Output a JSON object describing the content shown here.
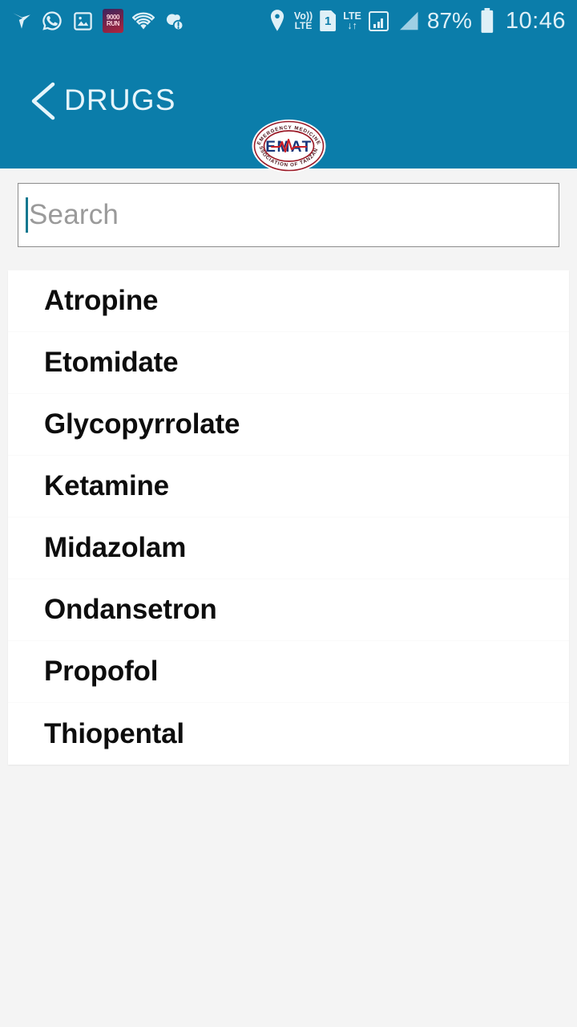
{
  "status_bar": {
    "left_icons": [
      {
        "name": "bird-app-icon",
        "label": "bird"
      },
      {
        "name": "whatsapp-icon",
        "label": "whatsapp"
      },
      {
        "name": "gallery-image-icon",
        "label": "image"
      },
      {
        "name": "purple-app-badge-icon",
        "label": "app"
      },
      {
        "name": "wifi-icon",
        "label": "wifi"
      },
      {
        "name": "sync-alert-icon",
        "label": "sync"
      }
    ],
    "location_icon": "location-pin-icon",
    "volte_line1": "Vo))",
    "volte_line2": "LTE",
    "sim_number": "1",
    "lte_label": "LTE",
    "lte_arrows": "↓↑",
    "signal_box_icon": "signal-bars-boxed-icon",
    "signal_triangle_icon": "signal-triangle-icon",
    "battery_percent": "87%",
    "battery_icon": "battery-icon",
    "time": "10:46"
  },
  "app_bar": {
    "back_icon": "back-chevron-icon",
    "title": "DRUGS",
    "logo": {
      "name": "emat-logo",
      "center_text": "EMAT",
      "arc_top": "EMERGENCY MEDICINE",
      "arc_bottom": "ASSOCIATION OF TANZANIA",
      "ring_color": "#9b1b28",
      "text_color": "#17357a",
      "wave_color": "#cc2027"
    }
  },
  "search": {
    "placeholder": "Search",
    "value": "",
    "caret_color": "#12788f"
  },
  "drug_list": {
    "items": [
      {
        "name": "Atropine"
      },
      {
        "name": "Etomidate"
      },
      {
        "name": "Glycopyrrolate"
      },
      {
        "name": "Ketamine"
      },
      {
        "name": "Midazolam"
      },
      {
        "name": "Ondansetron"
      },
      {
        "name": "Propofol"
      },
      {
        "name": "Thiopental"
      }
    ]
  },
  "theme": {
    "primary": "#0b7daa",
    "background": "#f4f4f4",
    "card": "#ffffff",
    "text": "#0d0d0d"
  }
}
